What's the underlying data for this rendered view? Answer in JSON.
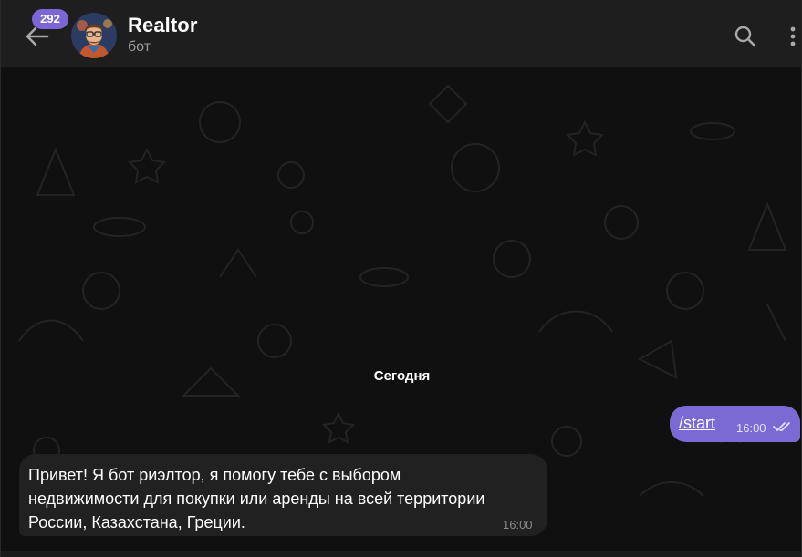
{
  "header": {
    "unread_badge": "292",
    "title": "Realtor",
    "subtitle": "бот",
    "icons": {
      "back": "arrow-left-icon",
      "search": "search-icon",
      "more": "more-vertical-icon"
    }
  },
  "chat": {
    "date_separator": "Сегодня",
    "messages": [
      {
        "direction": "outgoing",
        "text": "/start",
        "time": "16:00",
        "status": "read"
      },
      {
        "direction": "incoming",
        "text": "Привет! Я бот риэлтор, я помогу тебе с выбором недвижимости для покупки или аренды на всей территории России, Казахстана, Греции.",
        "time": "16:00"
      }
    ]
  },
  "colors": {
    "accent": "#7b6ad4",
    "badge": "#7c66d6",
    "header_bg": "#1e1e1e",
    "incoming_bubble": "#212121"
  }
}
